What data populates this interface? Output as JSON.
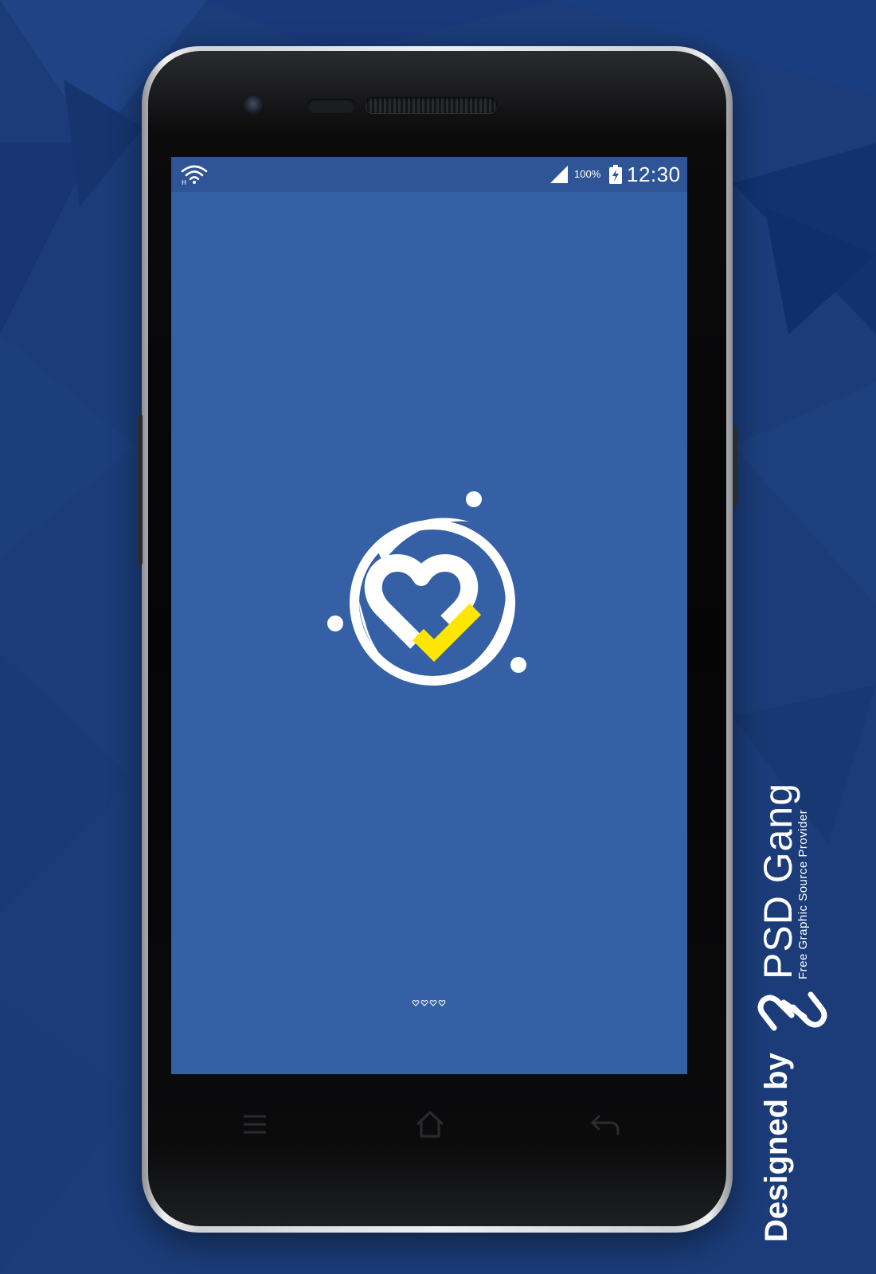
{
  "status_bar": {
    "battery_percent": "100%",
    "time": "12:30",
    "wifi_icon": "wifi-icon",
    "signal_icon": "cell-signal-icon",
    "battery_icon": "battery-charging-icon"
  },
  "splash": {
    "logo_icon": "heart-checkmark-logo",
    "loader_icon": "loading-hearts-indicator",
    "accent_color": "#ffe600",
    "background_color": "#3560a6"
  },
  "nav_bar": {
    "menu_icon": "menu-icon",
    "home_icon": "home-icon",
    "back_icon": "back-arrow-icon"
  },
  "watermark": {
    "designed_by": "Designed by",
    "brand": "PSD Gang",
    "tagline": "Free Graphic Source Provider"
  }
}
